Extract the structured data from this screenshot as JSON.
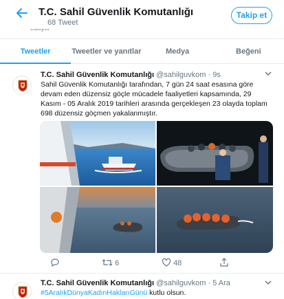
{
  "header": {
    "title": "T.C. Sahil Güvenlik Komutanlığı",
    "tweet_count": "68 Tweet",
    "follow_label": "Takip et",
    "hidden_text": "ediliyor"
  },
  "tabs": [
    {
      "label": "Tweetler",
      "active": true
    },
    {
      "label": "Tweetler ve yanıtlar",
      "active": false
    },
    {
      "label": "Medya",
      "active": false
    },
    {
      "label": "Beğeni",
      "active": false
    }
  ],
  "tweets": [
    {
      "name": "T.C. Sahil Güvenlik Komutanlığı",
      "handle": "@sahilguvkom",
      "time": "· 9s",
      "text": "Sahil Güvenlik Komutanlığı tarafından, 7 gün 24 saat esasına göre devam eden düzensiz göçle mücadele faaliyetleri kapsamında, 29 Kasım - 05 Aralık 2019 tarihleri arasında gerçekleşen 23 olayda toplam 698 düzensiz göçmen yakalanmıştır.",
      "photos": [
        "coast-guard-boat-at-sea",
        "migrants-in-dinghy-at-night",
        "rubber-boat-beside-ship-at-sunset",
        "migrants-in-life-jackets-on-raft"
      ],
      "replies": "",
      "retweets": "6",
      "likes": "48"
    },
    {
      "name": "T.C. Sahil Güvenlik Komutanlığı",
      "handle": "@sahilguvkom",
      "time": "· 5 Ara",
      "hashtag": "#5AralıkDünyaKadınHaklarıGünü",
      "text_after": " kutlu olsun."
    }
  ],
  "colors": {
    "accent": "#1da1f2",
    "text": "#14171a",
    "muted": "#657786",
    "border": "#e6ecf0"
  },
  "icons": [
    "back-arrow-icon",
    "caret-down-icon",
    "reply-icon",
    "retweet-icon",
    "like-icon",
    "share-icon"
  ]
}
